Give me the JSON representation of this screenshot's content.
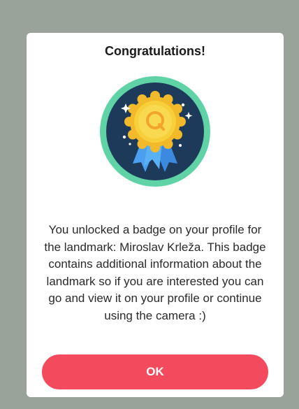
{
  "dialog": {
    "title": "Congratulations!",
    "message": "You unlocked a badge on your profile for the landmark: Miroslav Krleža. This badge contains additional information about the landmark so if you are interested you can go and view it on your profile or continue using the camera :)",
    "ok_label": "OK",
    "badge_icon": "award-medal-icon"
  },
  "colors": {
    "backdrop": "#9aa39a",
    "dialog_bg": "#ffffff",
    "badge_ring": "#5fd3a5",
    "badge_bg": "#1e3a5a",
    "medal_gold": "#f7cf3a",
    "ribbon_blue": "#4c9ff0",
    "ok_button": "#f44a5e"
  }
}
